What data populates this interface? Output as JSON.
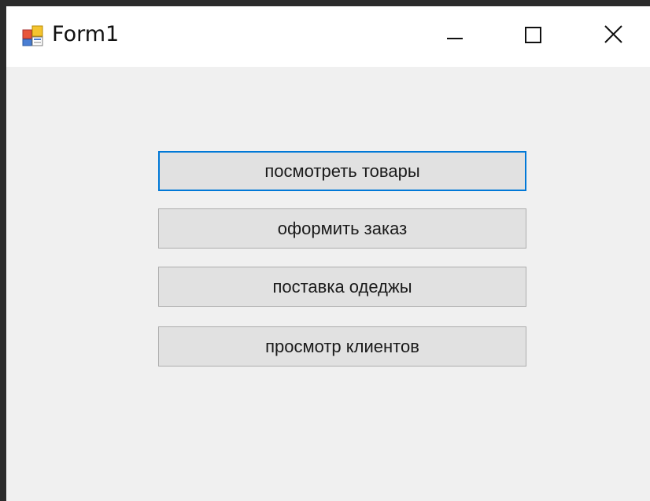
{
  "window": {
    "title": "Form1",
    "icon": "winforms-app-icon",
    "controls": {
      "minimize_icon": "minimize-icon",
      "maximize_icon": "maximize-icon",
      "close_icon": "close-icon"
    }
  },
  "buttons": [
    {
      "label": "посмотреть товары",
      "focused": true
    },
    {
      "label": "оформить заказ",
      "focused": false
    },
    {
      "label": "поставка одеджы",
      "focused": false
    },
    {
      "label": "просмотр клиентов",
      "focused": false
    }
  ],
  "colors": {
    "focus_border": "#0078d7",
    "button_face": "#e1e1e1",
    "form_background": "#f0f0f0",
    "titlebar": "#ffffff"
  }
}
